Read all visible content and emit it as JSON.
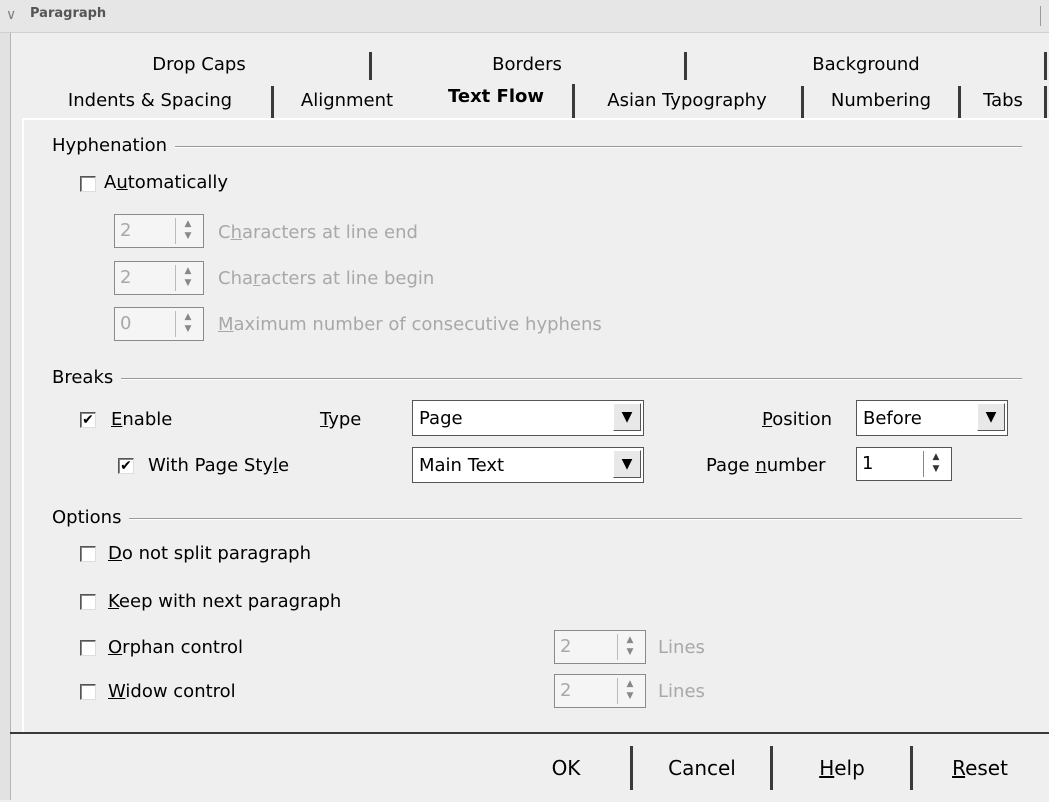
{
  "window": {
    "title": "Paragraph"
  },
  "tabs_row1": [
    "Drop Caps",
    "Borders",
    "Background"
  ],
  "tabs_row2": [
    "Indents & Spacing",
    "Alignment",
    "Text Flow",
    "Asian Typography",
    "Numbering",
    "Tabs"
  ],
  "active_tab": "Text Flow",
  "hyphenation": {
    "label": "Hyphenation",
    "automatically": {
      "pre": "A",
      "u": "u",
      "post": "tomatically",
      "checked": false
    },
    "chars_line_end": {
      "value": "2",
      "pre": "C",
      "u": "h",
      "post": "aracters at line end"
    },
    "chars_line_begin": {
      "value": "2",
      "pre": "Cha",
      "u": "r",
      "post": "acters at line begin"
    },
    "max_hyphens": {
      "value": "0",
      "pre": "",
      "u": "M",
      "post": "aximum number of consecutive hyphens"
    }
  },
  "breaks": {
    "label": "Breaks",
    "enable": {
      "pre": "",
      "u": "E",
      "post": "nable",
      "checked": true
    },
    "type_label": {
      "pre": "",
      "u": "T",
      "post": "ype"
    },
    "type_value": "Page",
    "position_label": {
      "pre": "",
      "u": "P",
      "post": "osition"
    },
    "position_value": "Before",
    "with_page_style": {
      "pre": "With Page Sty",
      "u": "l",
      "post": "e",
      "checked": true
    },
    "page_style_value": "Main Text",
    "page_number_label": {
      "pre": "Page ",
      "u": "n",
      "post": "umber"
    },
    "page_number_value": "1"
  },
  "options": {
    "label": "Options",
    "do_not_split": {
      "pre": "",
      "u": "D",
      "post": "o not split paragraph",
      "checked": false
    },
    "keep_with_next": {
      "pre": "",
      "u": "K",
      "post": "eep with next paragraph",
      "checked": false
    },
    "orphan": {
      "pre": "",
      "u": "O",
      "post": "rphan control",
      "checked": false,
      "lines": "2"
    },
    "widow": {
      "pre": "",
      "u": "W",
      "post": "idow control",
      "checked": false,
      "lines": "2"
    },
    "lines_label": "Lines"
  },
  "buttons": {
    "ok": "OK",
    "cancel": "Cancel",
    "help": {
      "pre": "",
      "u": "H",
      "post": "elp"
    },
    "reset": {
      "pre": "",
      "u": "R",
      "post": "eset"
    }
  },
  "glyphs": {
    "check": "✔",
    "down": "▼",
    "up_small": "▲",
    "down_small": "▼",
    "chevron": "❯"
  }
}
